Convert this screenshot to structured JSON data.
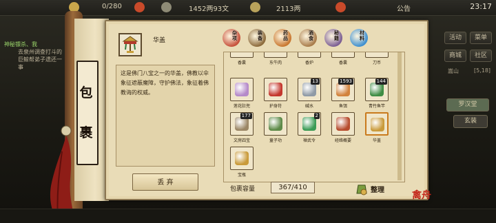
{
  "hud": {
    "gold_partial": "0/280",
    "money1": "1452两93文",
    "money2": "2113两",
    "notice": "公告",
    "clock": "23:17"
  },
  "quest": {
    "title": "神秘镖杀、我",
    "text": "去泉州调查打斗的巨鲸帮弟子遗还一事"
  },
  "sidebar": {
    "btn_huodong": "活动",
    "btn_caidan": "菜单",
    "btn_shangcheng": "商城",
    "btn_shequ": "社区",
    "line1_left": "嵩山",
    "line1_right": "[5,18]",
    "tag1": "罗汉堂",
    "tag2": "玄装"
  },
  "scroll": {
    "char1": "包",
    "char2": "裹"
  },
  "tabs": [
    {
      "label": "杂项",
      "icon": "misc-icon",
      "color": "#c6503a"
    },
    {
      "label": "装备",
      "icon": "equipment-icon",
      "color": "#8c6a3b"
    },
    {
      "label": "药品",
      "icon": "medicine-icon",
      "color": "#c8762e"
    },
    {
      "label": "酒食",
      "icon": "food-icon",
      "color": "#a87b4a"
    },
    {
      "label": "秘籍",
      "icon": "book-icon",
      "color": "#7b5e93"
    },
    {
      "label": "材料",
      "icon": "material-icon",
      "color": "#3e8fcf"
    }
  ],
  "selected": {
    "name": "华盖",
    "description": "这是佛门八宝之一的华盖，佛教以伞象征遮蔽魔障，守护佛法，象征着佛教诲的权威。"
  },
  "discard_label": "丢 弃",
  "grid": {
    "partial_names": [
      "香囊",
      "东牛肉",
      "香炉",
      "香囊",
      "刀币"
    ],
    "items": [
      {
        "name": "莲花肚兜",
        "count": "",
        "icon": "lotus-bib-icon",
        "color": "#b58ac9"
      },
      {
        "name": "护身符",
        "count": "",
        "icon": "amulet-icon",
        "color": "#c4372d"
      },
      {
        "name": "碱水",
        "count": "13",
        "icon": "alkali-water-icon",
        "color": "#8f9aa6"
      },
      {
        "name": "鱼饵",
        "count": "1593",
        "icon": "fish-bait-icon",
        "color": "#d2823c"
      },
      {
        "name": "青竹鱼竿",
        "count": "144",
        "icon": "bamboo-rod-icon",
        "color": "#3f8d44"
      },
      {
        "name": "文房四宝",
        "count": "177",
        "icon": "stationery-icon",
        "color": "#9b8665"
      },
      {
        "name": "童子功",
        "count": "",
        "icon": "scroll-manual-icon",
        "color": "#5d8a48"
      },
      {
        "name": "禅武令",
        "count": "2",
        "icon": "zen-token-icon",
        "color": "#3b9b55"
      },
      {
        "name": "经络概要",
        "count": "",
        "icon": "meridian-book-icon",
        "color": "#b74c2e"
      },
      {
        "name": "华盖",
        "count": "",
        "icon": "canopy-icon",
        "color": "#c99a3a"
      },
      {
        "name": "宝瓶",
        "count": "",
        "icon": "treasure-vase-icon",
        "color": "#c99a3a"
      }
    ]
  },
  "capacity": {
    "label": "包裹容量",
    "value": "367/410"
  },
  "sort_label": "整理",
  "watermark": "禽舟"
}
